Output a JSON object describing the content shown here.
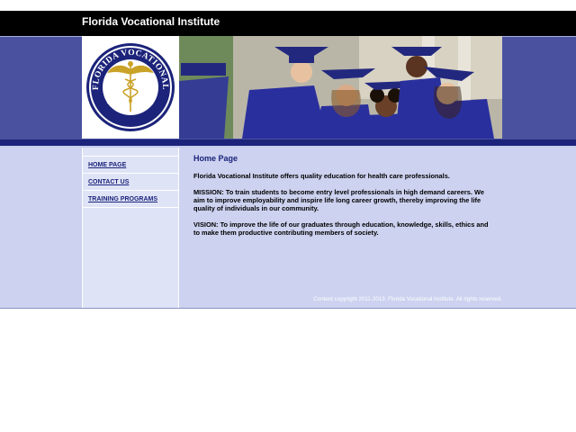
{
  "site": {
    "title": "Florida Vocational Institute",
    "logo": {
      "top_text": "FLORIDA VOCATIONAL",
      "bottom_text": "INSTITUTE",
      "icon": "caduceus-icon"
    }
  },
  "nav": {
    "items": [
      {
        "label": "HOME PAGE"
      },
      {
        "label": "CONTACT US"
      },
      {
        "label": "TRAINING PROGRAMS"
      }
    ]
  },
  "main": {
    "heading": "Home Page",
    "intro": "Florida Vocational Institute offers quality education for health care professionals.",
    "mission": "MISSION:  To train students to become entry level professionals in high demand careers. We aim to improve employability and inspire life long career growth, thereby improving the life quality of individuals in our community.",
    "vision": "VISION: To improve the life of our graduates through education, knowledge, skills, ethics and to make them productive contributing members of society."
  },
  "footer": {
    "copyright": "Content copyright 2011-2013. Florida Vocational Institute. All rights reserved."
  },
  "colors": {
    "header_bg": "#000000",
    "banner_bg": "#4a52a0",
    "nav_strip": "#1b237a",
    "content_bg": "#ccd2ef",
    "sidebar_bg": "#dfe3f6",
    "link": "#1b237a",
    "gown_blue": "#2a2f9e"
  }
}
